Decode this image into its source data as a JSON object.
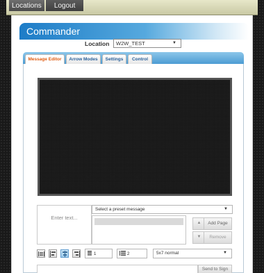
{
  "nav": {
    "locations": "Locations",
    "logout": "Logout"
  },
  "header": {
    "title": "Commander"
  },
  "location": {
    "label": "Location",
    "value": "W2W_TEST"
  },
  "tabs": [
    {
      "label": "Message Editor",
      "active": true
    },
    {
      "label": "Arrow Modes"
    },
    {
      "label": "Settings"
    },
    {
      "label": "Control"
    }
  ],
  "editor": {
    "text_placeholder": "Enter text...",
    "preset_placeholder": "Select a preset message",
    "up_icon": "▲",
    "down_icon": "▼",
    "add_page": "Add Page",
    "remove": "Remove",
    "spacing_value": "1",
    "lines_value": "2",
    "font_value": "5x7 normal",
    "send_to_sign": "Send to Sign"
  },
  "icons": {
    "toolbar": [
      "align-fill-icon",
      "align-left-icon",
      "align-center-icon",
      "align-right-icon",
      "char-spacing-icon",
      "line-count-icon"
    ],
    "dropdown": "chevron-down-icon"
  },
  "colors": {
    "accent": "#1d7cc7",
    "active_tab": "#e05c12",
    "tab_text": "#2a6099",
    "sign_background": "#141414"
  }
}
